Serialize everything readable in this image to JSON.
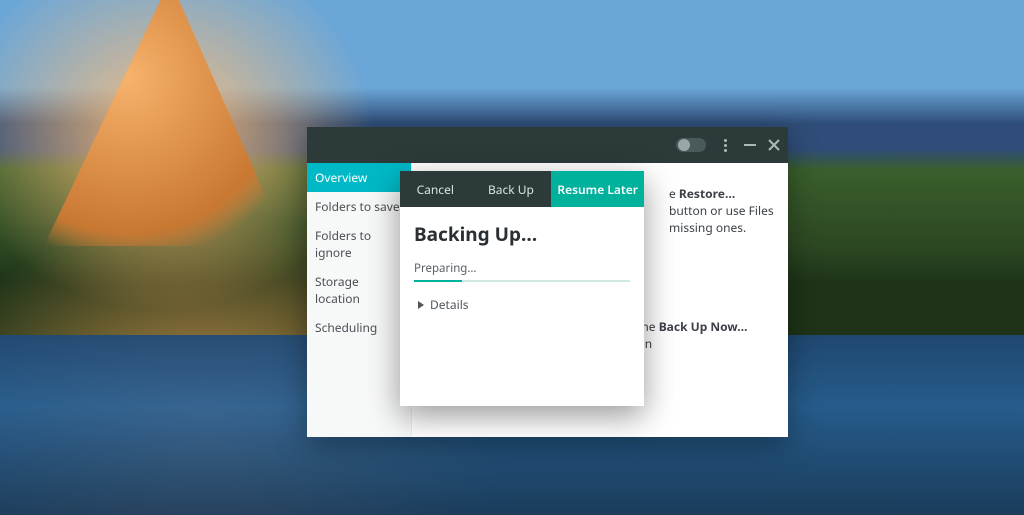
{
  "colors": {
    "accent_cyan": "#00b9c6",
    "accent_teal": "#00b19c",
    "titlebar": "#2c3a3a"
  },
  "window": {
    "titlebar": {
      "toggle_state": "off"
    },
    "sidebar": {
      "items": [
        {
          "label": "Overview",
          "active": true
        },
        {
          "label": "Folders to save",
          "active": false
        },
        {
          "label": "Folders to ignore",
          "active": false
        },
        {
          "label": "Storage location",
          "active": false
        },
        {
          "label": "Scheduling",
          "active": false
        }
      ]
    },
    "content": {
      "hint1_prefix": "e ",
      "hint1_bold": "Restore…",
      "hint1_suffix": " button or use Files",
      "hint1_line2": "missing ones.",
      "hint2_prefix": "use the ",
      "hint2_bold": "Back Up Now…",
      "hint2_suffix": " button"
    }
  },
  "dialog": {
    "buttons": {
      "cancel": "Cancel",
      "backup": "Back Up",
      "resume": "Resume Later"
    },
    "title": "Backing Up…",
    "status": "Preparing…",
    "progress_percent": 22,
    "details_label": "Details"
  }
}
